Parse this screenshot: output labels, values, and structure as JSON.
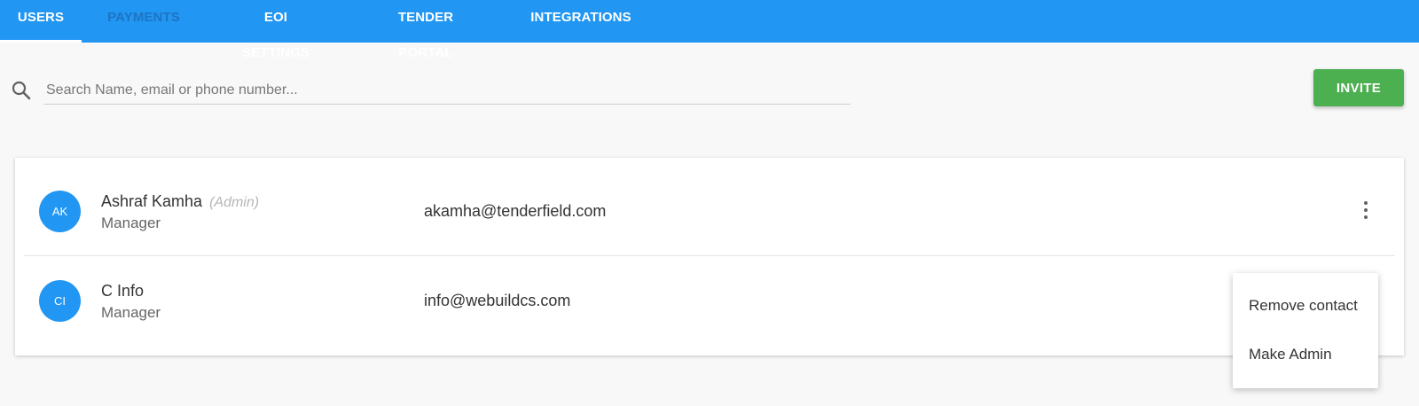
{
  "tabs": [
    {
      "label": "USERS",
      "active": true,
      "disabled": false
    },
    {
      "label": "PAYMENTS",
      "active": false,
      "disabled": true
    },
    {
      "label": "EOI SETTINGS",
      "active": false,
      "disabled": false
    },
    {
      "label": "TENDER PORTAL",
      "active": false,
      "disabled": false
    },
    {
      "label": "INTEGRATIONS",
      "active": false,
      "disabled": false
    }
  ],
  "search": {
    "placeholder": "Search Name, email or phone number...",
    "value": ""
  },
  "invite_label": "INVITE",
  "users": [
    {
      "initials": "AK",
      "name": "Ashraf Kamha",
      "admin_tag": "(Admin)",
      "role": "Manager",
      "email": "akamha@tenderfield.com"
    },
    {
      "initials": "CI",
      "name": "C Info",
      "admin_tag": "",
      "role": "Manager",
      "email": "info@webuildcs.com"
    }
  ],
  "context_menu": {
    "items": [
      "Remove contact",
      "Make Admin"
    ]
  },
  "colors": {
    "primary": "#2196f3",
    "invite": "#4caf50",
    "background": "#f8f8f8"
  },
  "icons": {
    "search": "search-icon",
    "more": "more-vert-icon"
  }
}
